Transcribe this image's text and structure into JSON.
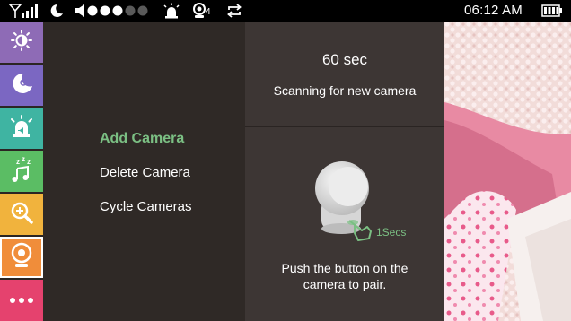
{
  "status_bar": {
    "time": "06:12 AM",
    "parent_count": "4",
    "icons": [
      "signal-wifi-icon",
      "night-mode-icon",
      "volume-icon",
      "volume-level-dots",
      "alarm-icon",
      "parent-unit-icon",
      "repeat-icon",
      "battery-icon"
    ],
    "volume_level": 3,
    "volume_max": 5
  },
  "sidebar": {
    "items": [
      {
        "icon": "brightness-icon",
        "color": "#8e6bb6"
      },
      {
        "icon": "night-light-icon",
        "color": "#7b67c2"
      },
      {
        "icon": "alert-icon",
        "color": "#3fb4a2"
      },
      {
        "icon": "lullaby-icon",
        "color": "#5bbd64"
      },
      {
        "icon": "zoom-icon",
        "color": "#f1b33d"
      },
      {
        "icon": "camera-icon",
        "color": "#f08d3a",
        "active": true
      },
      {
        "icon": "more-icon",
        "color": "#e5426e"
      }
    ]
  },
  "menu": {
    "items": [
      {
        "label": "Add Camera",
        "active": true
      },
      {
        "label": "Delete Camera",
        "active": false
      },
      {
        "label": "Cycle Cameras",
        "active": false
      }
    ],
    "active_color": "#7bbf83"
  },
  "pairing": {
    "countdown": "60 sec",
    "status": "Scanning for new camera",
    "hold_time": "1Secs",
    "instruction": "Push the button on the camera to pair."
  }
}
